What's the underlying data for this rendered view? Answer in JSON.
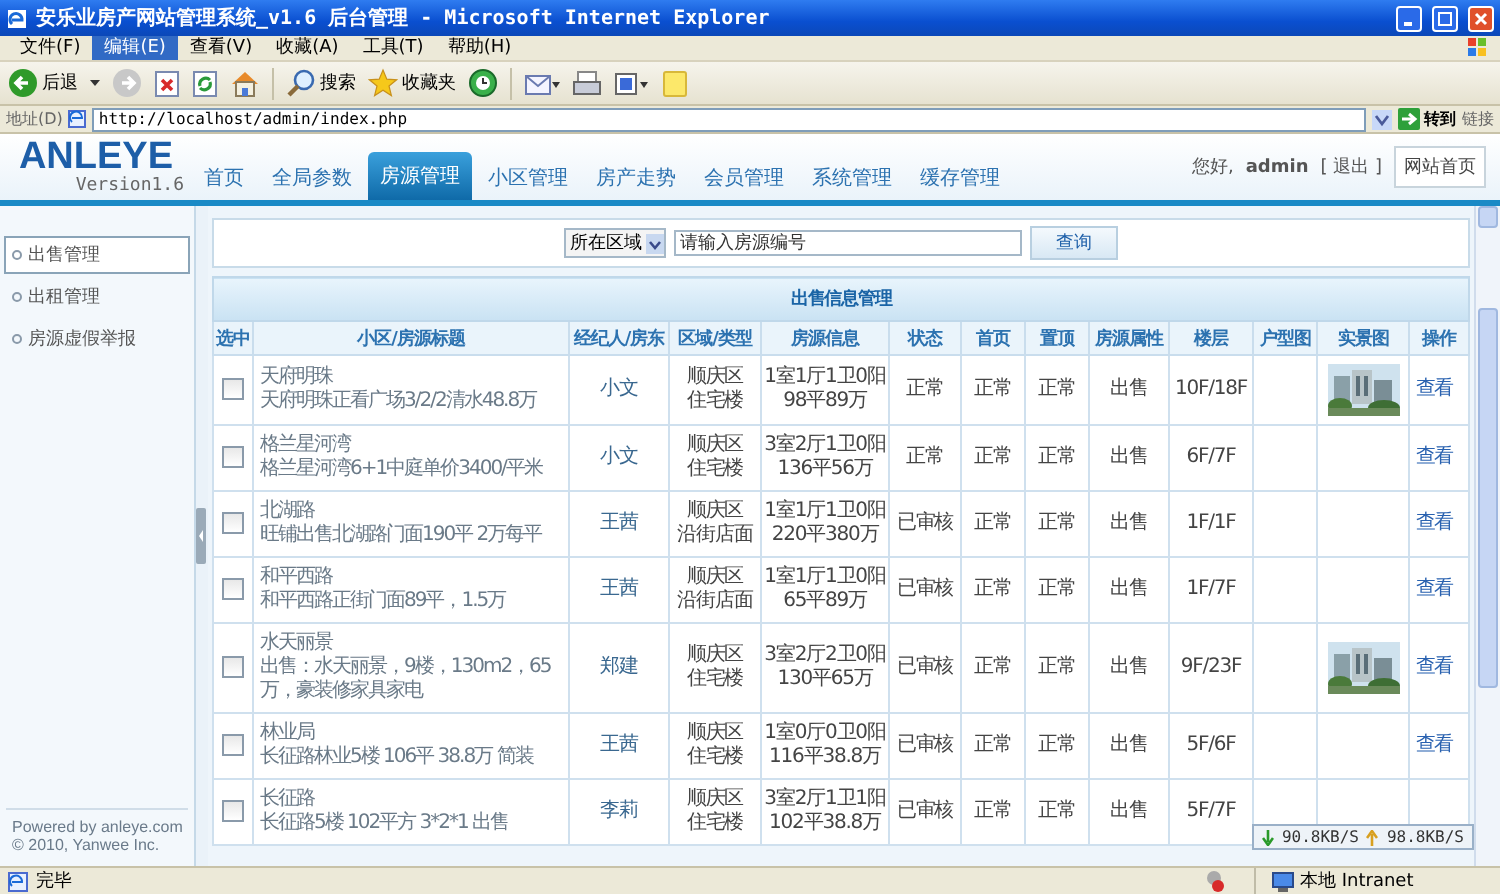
{
  "window": {
    "title": "安乐业房产网站管理系统_v1.6 后台管理 - Microsoft Internet Explorer"
  },
  "menu": [
    {
      "label": "文件(F)",
      "selected": false
    },
    {
      "label": "编辑(E)",
      "selected": true
    },
    {
      "label": "查看(V)",
      "selected": false
    },
    {
      "label": "收藏(A)",
      "selected": false
    },
    {
      "label": "工具(T)",
      "selected": false
    },
    {
      "label": "帮助(H)",
      "selected": false
    }
  ],
  "toolbar": {
    "back": "后退",
    "search": "搜索",
    "favorites": "收藏夹"
  },
  "address": {
    "label": "地址(D)",
    "url": "http://localhost/admin/index.php",
    "go": "转到",
    "links": "链接"
  },
  "header": {
    "logo": "ANLEYE",
    "version": "Version1.6",
    "greeting": "您好,",
    "user": "admin",
    "logout": "[ 退出 ]",
    "home_button": "网站首页",
    "nav": [
      {
        "label": "首页",
        "selected": false
      },
      {
        "label": "全局参数",
        "selected": false
      },
      {
        "label": "房源管理",
        "selected": true
      },
      {
        "label": "小区管理",
        "selected": false
      },
      {
        "label": "房产走势",
        "selected": false
      },
      {
        "label": "会员管理",
        "selected": false
      },
      {
        "label": "系统管理",
        "selected": false
      },
      {
        "label": "缓存管理",
        "selected": false
      }
    ]
  },
  "sidebar": {
    "items": [
      {
        "label": "出售管理",
        "selected": true
      },
      {
        "label": "出租管理",
        "selected": false
      },
      {
        "label": "房源虚假举报",
        "selected": false
      }
    ],
    "footer": [
      "Powered by anleye.com",
      "© 2010, Yanwee Inc."
    ]
  },
  "search": {
    "region_select": "所在区域",
    "placeholder": "请输入房源编号",
    "button": "查询"
  },
  "table": {
    "title": "出售信息管理",
    "columns": [
      "选中",
      "小区/房源标题",
      "经纪人/房东",
      "区域/类型",
      "房源信息",
      "状态",
      "首页",
      "置顶",
      "房源属性",
      "楼层",
      "户型图",
      "实景图",
      "操作"
    ],
    "rows": [
      {
        "checked": false,
        "community": "天府明珠",
        "title": "天府明珠正看广场3/2/2清水48.8万",
        "agent": "小文",
        "district": "顺庆区",
        "type": "住宅楼",
        "layout": "1室1厅1卫0阳",
        "area_price": "98平89万",
        "status": "正常",
        "homepage": "正常",
        "top": "正常",
        "property": "出售",
        "floor": "10F/18F",
        "photo": true,
        "action": "查看"
      },
      {
        "checked": false,
        "community": "格兰星河湾",
        "title": "格兰星河湾6+1中庭单价3400/平米",
        "agent": "小文",
        "district": "顺庆区",
        "type": "住宅楼",
        "layout": "3室2厅1卫0阳",
        "area_price": "136平56万",
        "status": "正常",
        "homepage": "正常",
        "top": "正常",
        "property": "出售",
        "floor": "6F/7F",
        "photo": false,
        "action": "查看"
      },
      {
        "checked": false,
        "community": "北湖路",
        "title": "旺铺出售北湖路门面190平 2万每平",
        "agent": "王茜",
        "district": "顺庆区",
        "type": "沿街店面",
        "layout": "1室1厅1卫0阳",
        "area_price": "220平380万",
        "status": "已审核",
        "homepage": "正常",
        "top": "正常",
        "property": "出售",
        "floor": "1F/1F",
        "photo": false,
        "action": "查看"
      },
      {
        "checked": false,
        "community": "和平西路",
        "title": "和平西路正街门面89平，1.5万",
        "agent": "王茜",
        "district": "顺庆区",
        "type": "沿街店面",
        "layout": "1室1厅1卫0阳",
        "area_price": "65平89万",
        "status": "已审核",
        "homepage": "正常",
        "top": "正常",
        "property": "出售",
        "floor": "1F/7F",
        "photo": false,
        "action": "查看"
      },
      {
        "checked": false,
        "community": "水天丽景",
        "title": "出售：水天丽景，9楼，130m2，65万，豪装修家具家电",
        "agent": "郑建",
        "district": "顺庆区",
        "type": "住宅楼",
        "layout": "3室2厅2卫0阳",
        "area_price": "130平65万",
        "status": "已审核",
        "homepage": "正常",
        "top": "正常",
        "property": "出售",
        "floor": "9F/23F",
        "photo": true,
        "action": "查看"
      },
      {
        "checked": false,
        "community": "林业局",
        "title": "长征路林业5楼 106平 38.8万 简装",
        "agent": "王茜",
        "district": "顺庆区",
        "type": "住宅楼",
        "layout": "1室0厅0卫0阳",
        "area_price": "116平38.8万",
        "status": "已审核",
        "homepage": "正常",
        "top": "正常",
        "property": "出售",
        "floor": "5F/6F",
        "photo": false,
        "action": "查看"
      },
      {
        "checked": false,
        "community": "长征路",
        "title": "长征路5楼 102平方 3*2*1 出售",
        "agent": "李莉",
        "district": "顺庆区",
        "type": "住宅楼",
        "layout": "3室2厅1卫1阳",
        "area_price": "102平38.8万",
        "status": "已审核",
        "homepage": "正常",
        "top": "正常",
        "property": "出售",
        "floor": "5F/7F",
        "photo": false
      }
    ]
  },
  "speed_meter": {
    "down": "90.8KB/S",
    "up": "98.8KB/S"
  },
  "status_bar": {
    "text": "完毕",
    "zone": "本地 Intranet"
  }
}
